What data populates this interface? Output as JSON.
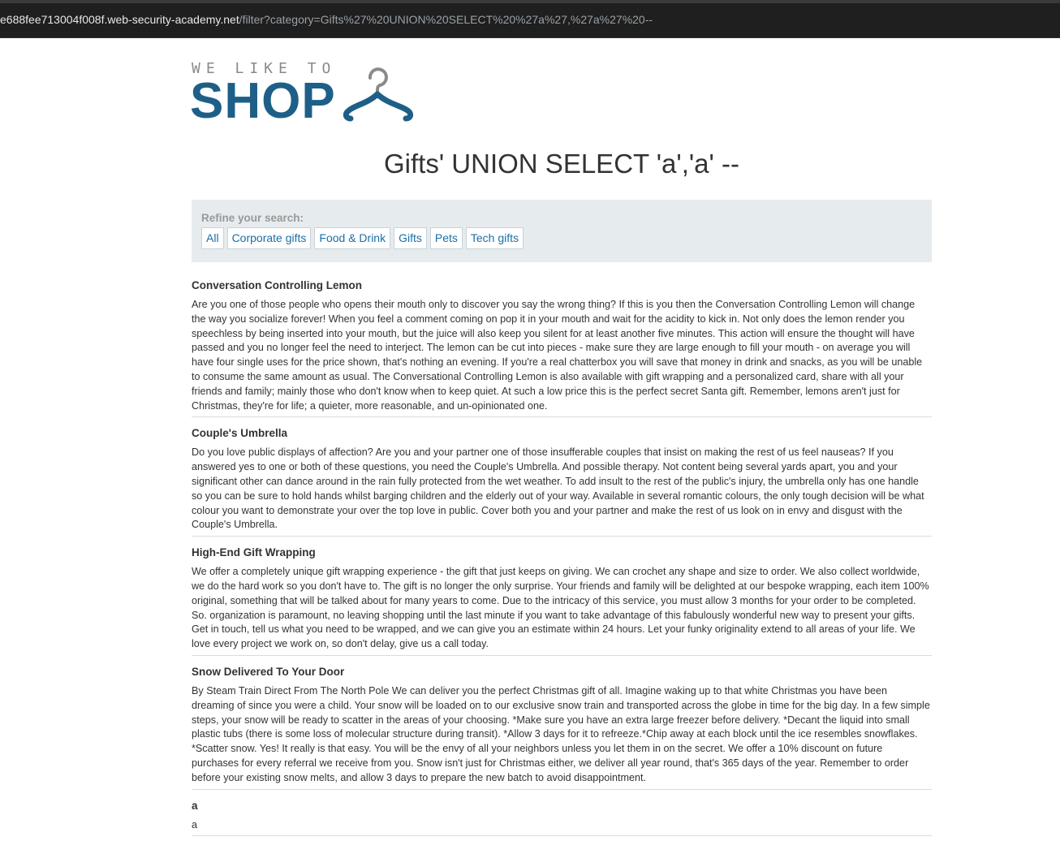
{
  "browser": {
    "url_host": "e688fee713004f008f.web-security-academy.net",
    "url_path": "/filter?category=Gifts%27%20UNION%20SELECT%20%27a%27,%27a%27%20--"
  },
  "logo": {
    "tagline": "WE LIKE TO",
    "word": "SHOP",
    "icon": "hanger-icon",
    "color": "#1e5f87"
  },
  "page_title": "Gifts' UNION SELECT 'a','a' --",
  "filter": {
    "label": "Refine your search:",
    "categories": [
      "All",
      "Corporate gifts",
      "Food & Drink",
      "Gifts",
      "Pets",
      "Tech gifts"
    ]
  },
  "products": [
    {
      "name": "Conversation Controlling Lemon",
      "description": "Are you one of those people who opens their mouth only to discover you say the wrong thing? If this is you then the Conversation Controlling Lemon will change the way you socialize forever! When you feel a comment coming on pop it in your mouth and wait for the acidity to kick in. Not only does the lemon render you speechless by being inserted into your mouth, but the juice will also keep you silent for at least another five minutes. This action will ensure the thought will have passed and you no longer feel the need to interject. The lemon can be cut into pieces - make sure they are large enough to fill your mouth - on average you will have four single uses for the price shown, that's nothing an evening. If you're a real chatterbox you will save that money in drink and snacks, as you will be unable to consume the same amount as usual. The Conversational Controlling Lemon is also available with gift wrapping and a personalized card, share with all your friends and family; mainly those who don't know when to keep quiet. At such a low price this is the perfect secret Santa gift. Remember, lemons aren't just for Christmas, they're for life; a quieter, more reasonable, and un-opinionated one."
    },
    {
      "name": "Couple's Umbrella",
      "description": "Do you love public displays of affection? Are you and your partner one of those insufferable couples that insist on making the rest of us feel nauseas? If you answered yes to one or both of these questions, you need the Couple's Umbrella. And possible therapy. Not content being several yards apart, you and your significant other can dance around in the rain fully protected from the wet weather. To add insult to the rest of the public's injury, the umbrella only has one handle so you can be sure to hold hands whilst barging children and the elderly out of your way. Available in several romantic colours, the only tough decision will be what colour you want to demonstrate your over the top love in public. Cover both you and your partner and make the rest of us look on in envy and disgust with the Couple's Umbrella."
    },
    {
      "name": "High-End Gift Wrapping",
      "description": "We offer a completely unique gift wrapping experience - the gift that just keeps on giving. We can crochet any shape and size to order. We also collect worldwide, we do the hard work so you don't have to. The gift is no longer the only surprise. Your friends and family will be delighted at our bespoke wrapping, each item 100% original, something that will be talked about for many years to come. Due to the intricacy of this service, you must allow 3 months for your order to be completed. So. organization is paramount, no leaving shopping until the last minute if you want to take advantage of this fabulously wonderful new way to present your gifts. Get in touch, tell us what you need to be wrapped, and we can give you an estimate within 24 hours. Let your funky originality extend to all areas of your life. We love every project we work on, so don't delay, give us a call today."
    },
    {
      "name": "Snow Delivered To Your Door",
      "description": "By Steam Train Direct From The North Pole We can deliver you the perfect Christmas gift of all. Imagine waking up to that white Christmas you have been dreaming of since you were a child. Your snow will be loaded on to our exclusive snow train and transported across the globe in time for the big day. In a few simple steps, your snow will be ready to scatter in the areas of your choosing. *Make sure you have an extra large freezer before delivery. *Decant the liquid into small plastic tubs (there is some loss of molecular structure during transit). *Allow 3 days for it to refreeze.*Chip away at each block until the ice resembles snowflakes. *Scatter snow. Yes! It really is that easy. You will be the envy of all your neighbors unless you let them in on the secret. We offer a 10% discount on future purchases for every referral we receive from you. Snow isn't just for Christmas either, we deliver all year round, that's 365 days of the year. Remember to order before your existing snow melts, and allow 3 days to prepare the new batch to avoid disappointment."
    },
    {
      "name": "a",
      "description": "a"
    }
  ]
}
